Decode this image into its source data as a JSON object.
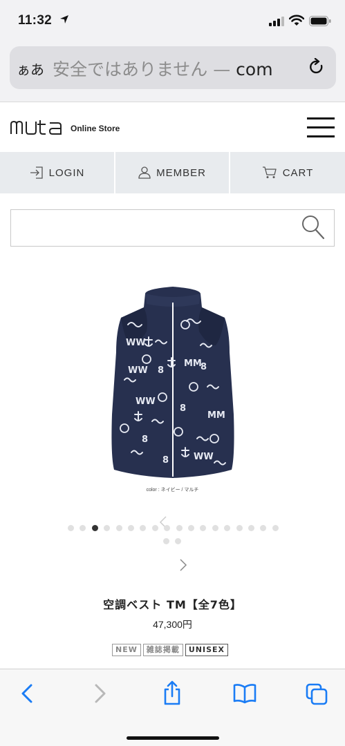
{
  "status_bar": {
    "time": "11:32"
  },
  "address_bar": {
    "aa_label": "ぁあ",
    "security_text": "安全ではありません — ",
    "domain_text": "com"
  },
  "header": {
    "logo_text": "muta",
    "store_label": "Online Store"
  },
  "nav": {
    "login": "LOGIN",
    "member": "MEMBER",
    "cart": "CART"
  },
  "search": {
    "placeholder": ""
  },
  "product": {
    "image_caption": "color : ネイビー / マルチ",
    "name": "空調ベスト TM【全7色】",
    "price": "47,300円",
    "badges": [
      "NEW",
      "雑誌掲載",
      "UNISEX"
    ]
  },
  "carousel": {
    "total_images": 20,
    "active_index": 2
  },
  "colors": {
    "accent_blue": "#1a7cf5",
    "nav_bg": "#e8ebee",
    "vest_navy": "#27304f"
  }
}
